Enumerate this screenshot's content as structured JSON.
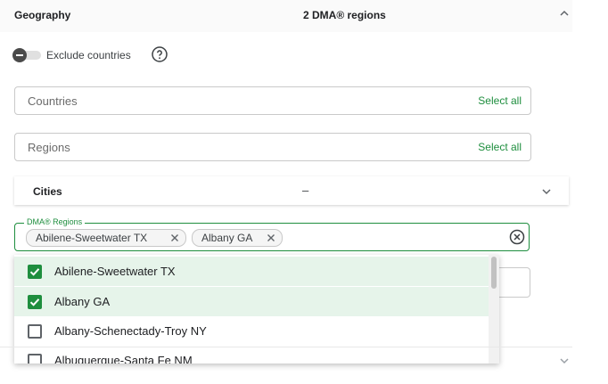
{
  "header": {
    "title": "Geography",
    "summary": "2 DMA® regions"
  },
  "exclude": {
    "label": "Exclude countries",
    "enabled": false
  },
  "countries": {
    "placeholder": "Countries",
    "select_all": "Select all"
  },
  "regions": {
    "placeholder": "Regions",
    "select_all": "Select all"
  },
  "cities": {
    "label": "Cities",
    "summary": "–"
  },
  "dma": {
    "legend": "DMA® Regions",
    "chips": [
      {
        "label": "Abilene-Sweetwater TX"
      },
      {
        "label": "Albany GA"
      }
    ]
  },
  "options": [
    {
      "label": "Abilene-Sweetwater TX",
      "checked": true
    },
    {
      "label": "Albany GA",
      "checked": true
    },
    {
      "label": "Albany-Schenectady-Troy NY",
      "checked": false
    },
    {
      "label": "Albuquerque-Santa Fe NM",
      "checked": false
    }
  ],
  "colors": {
    "accent": "#1e8e3e",
    "selected_bg": "#e6f4ea"
  },
  "icons": {
    "header_caret": "chevron-up-icon",
    "help": "help-circle-icon",
    "cities_caret": "chevron-down-icon",
    "chip_remove": "close-icon",
    "clear_all": "clear-circle-icon"
  }
}
